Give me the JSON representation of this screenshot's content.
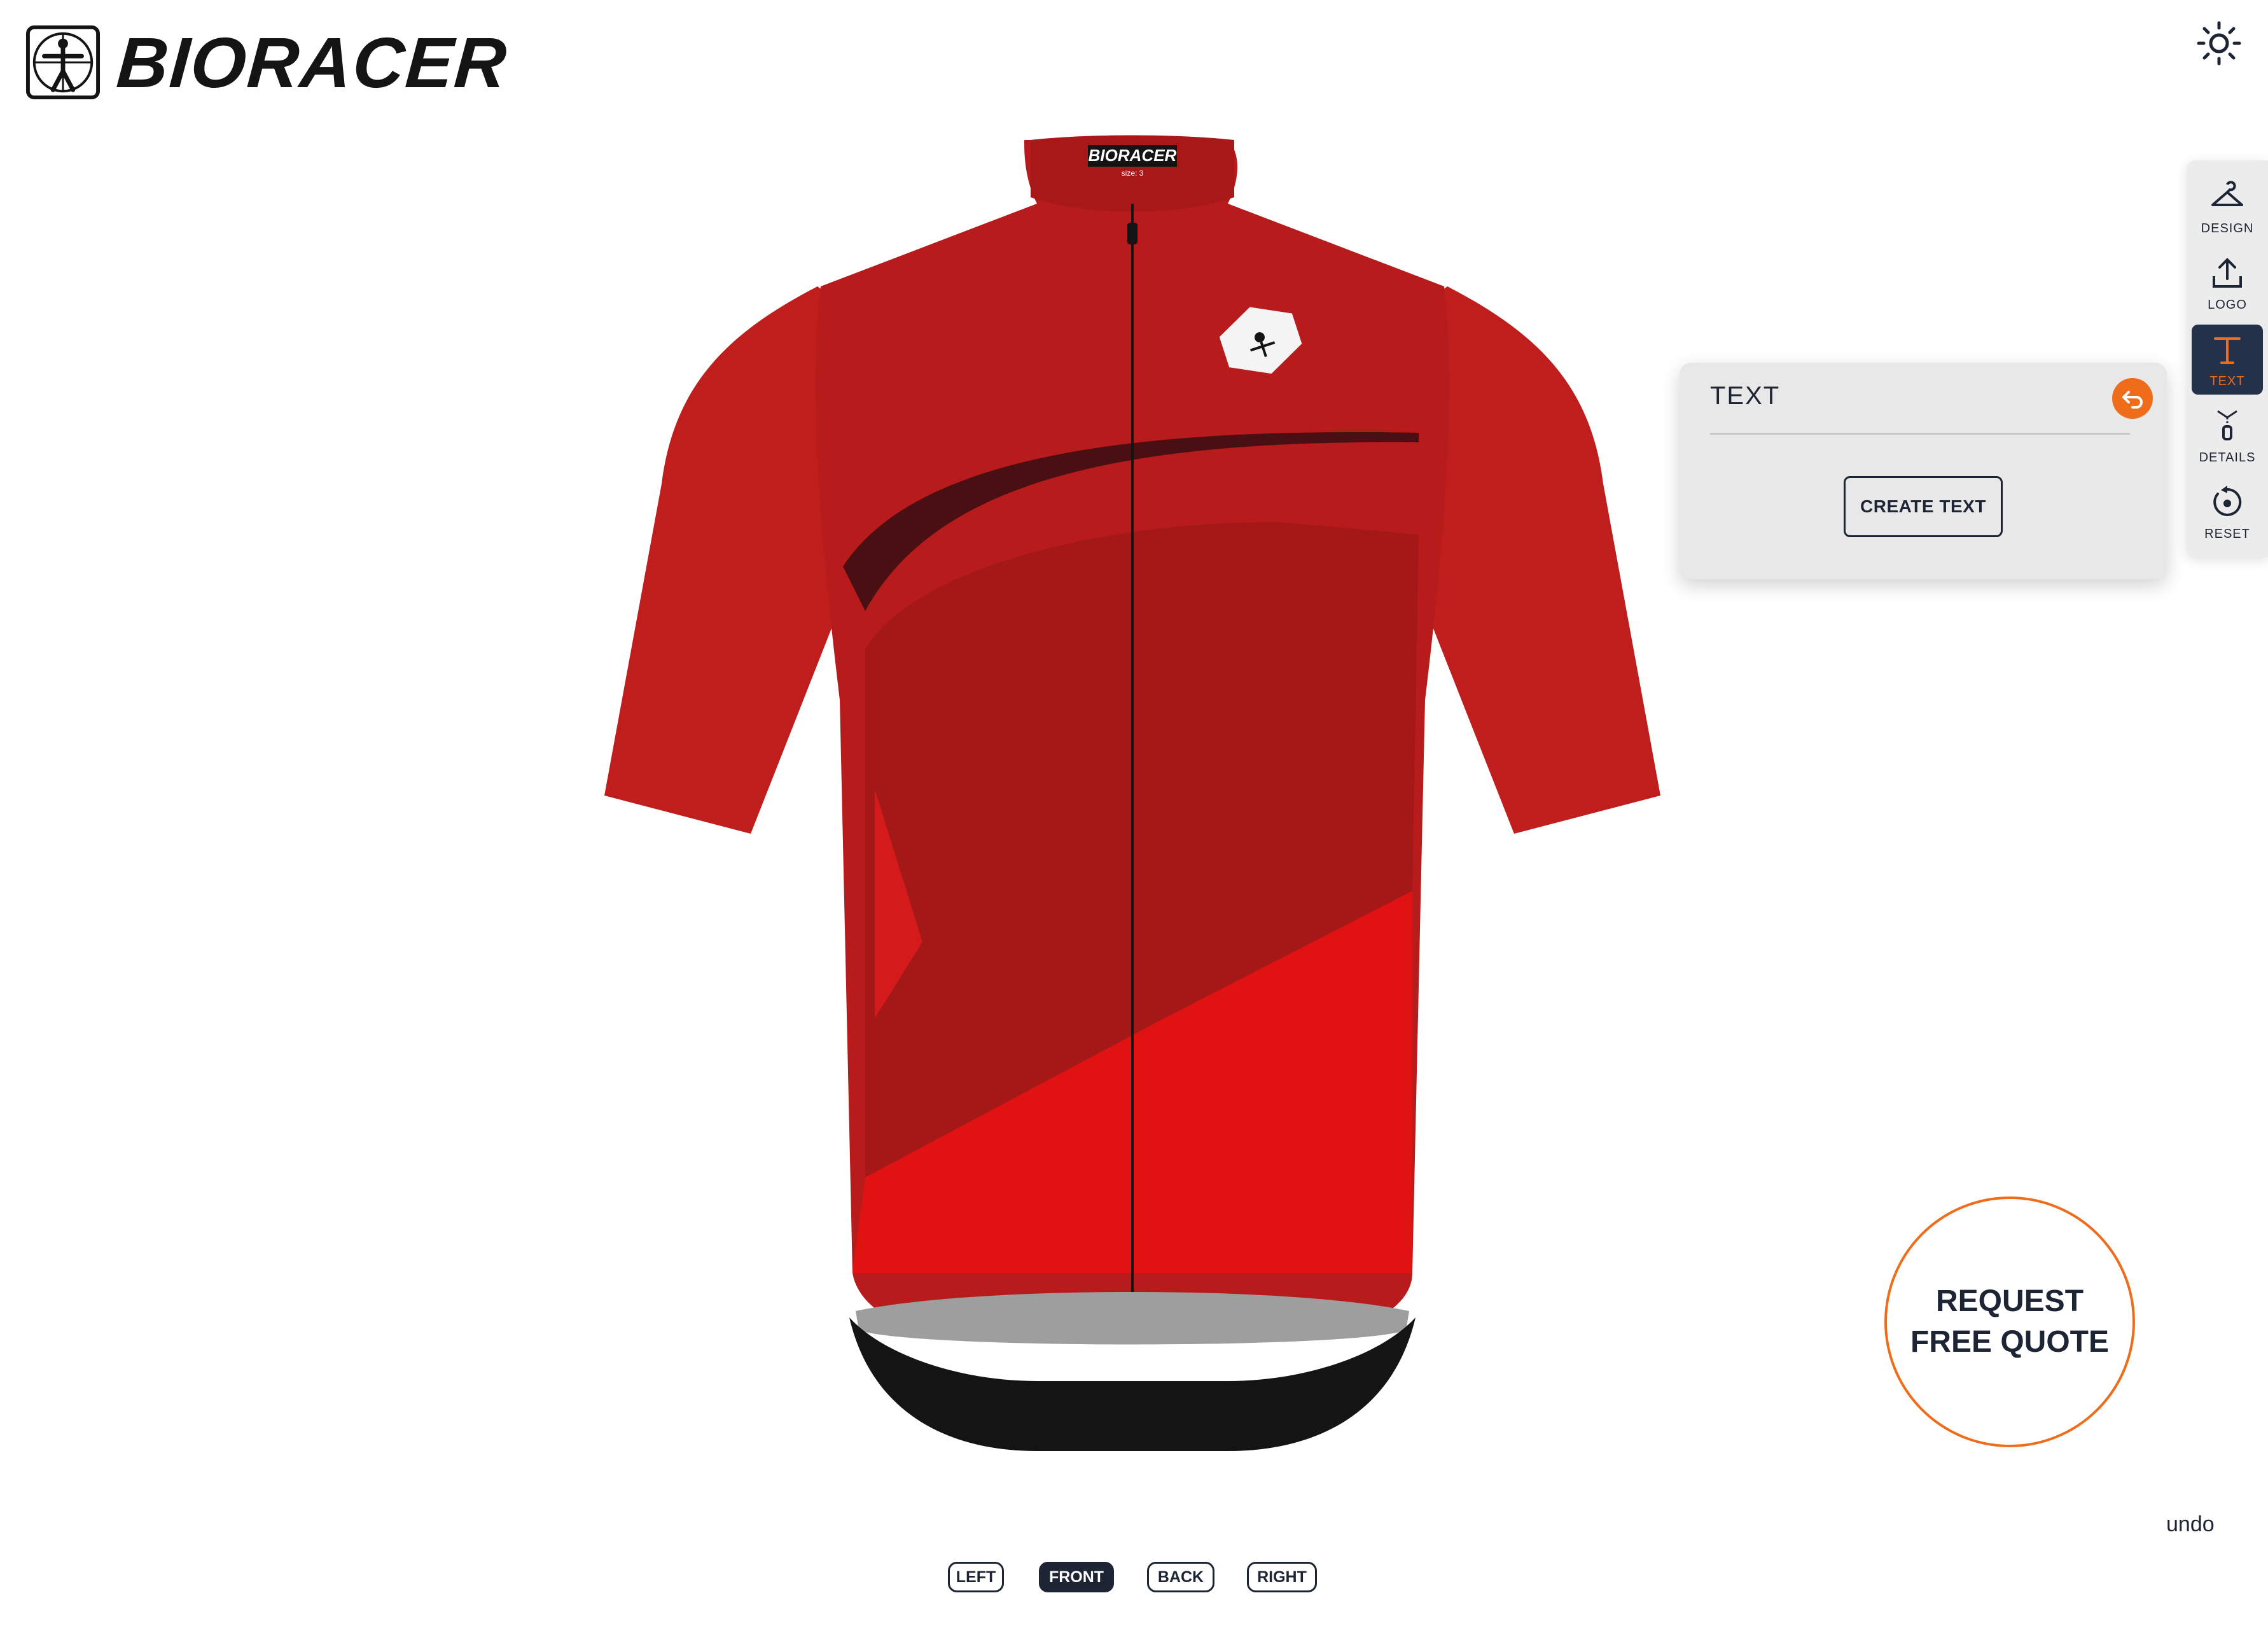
{
  "brand": {
    "name": "BIORACER"
  },
  "header": {
    "theme_icon": "sun-icon"
  },
  "jersey": {
    "collar_label": "BIORACER",
    "collar_size": "size: 3",
    "colors": {
      "main": "#b81b1b",
      "dark_panel": "#a51818",
      "bright_panel": "#e01212",
      "stripe": "#4a0f12",
      "hem": "#141414",
      "lining": "#9e9e9e"
    }
  },
  "toolbar": {
    "items": [
      {
        "label": "DESIGN",
        "icon": "hanger-icon"
      },
      {
        "label": "LOGO",
        "icon": "upload-icon"
      },
      {
        "label": "TEXT",
        "icon": "text-icon",
        "active": true
      },
      {
        "label": "DETAILS",
        "icon": "zipper-icon"
      },
      {
        "label": "RESET",
        "icon": "reset-icon"
      }
    ]
  },
  "text_panel": {
    "title": "TEXT",
    "create_button": "CREATE TEXT"
  },
  "quote": {
    "label": "REQUEST FREE QUOTE"
  },
  "undo": {
    "label": "undo"
  },
  "views": {
    "items": [
      {
        "label": "LEFT"
      },
      {
        "label": "FRONT",
        "active": true
      },
      {
        "label": "BACK"
      },
      {
        "label": "RIGHT"
      }
    ]
  },
  "accent_color": "#ef6c1a"
}
